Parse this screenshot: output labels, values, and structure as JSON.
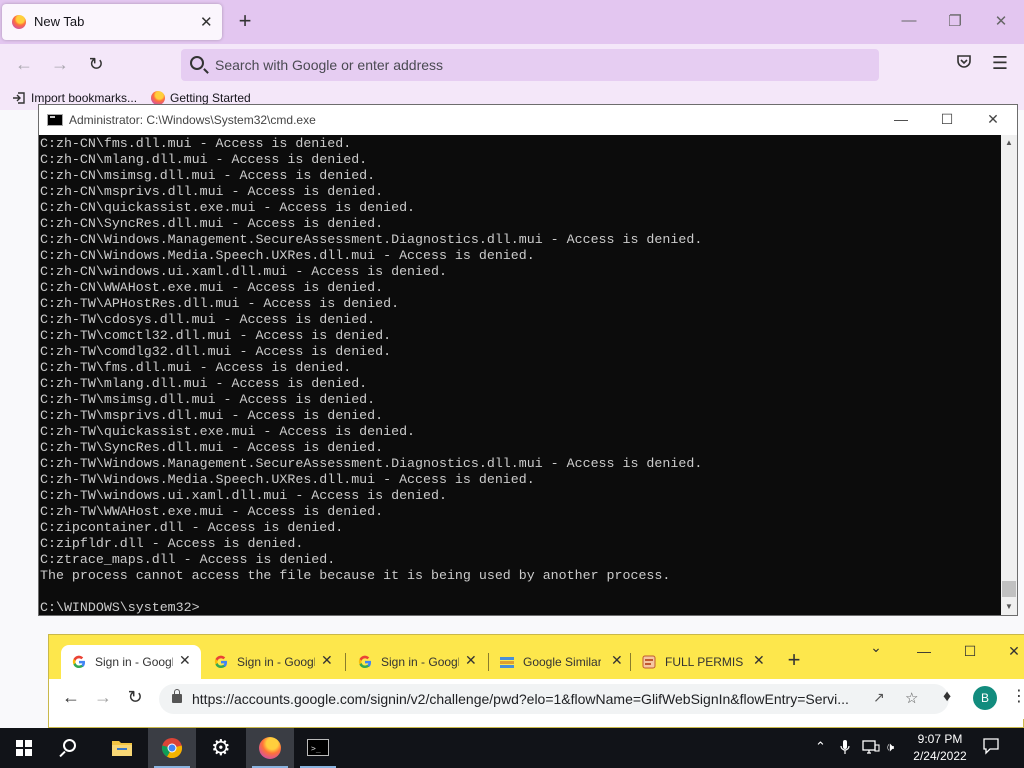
{
  "firefox": {
    "tab_title": "New Tab",
    "tab_close": "✕",
    "new_tab": "+",
    "url_placeholder": "Search with Google or enter address",
    "bookmarks": [
      {
        "label": "Import bookmarks..."
      },
      {
        "label": "Getting Started"
      }
    ],
    "win_minimize": "—",
    "win_restore": "❐",
    "win_close": "✕"
  },
  "cmd": {
    "title": "Administrator: C:\\Windows\\System32\\cmd.exe",
    "lines": [
      "C:zh-CN\\fms.dll.mui - Access is denied.",
      "C:zh-CN\\mlang.dll.mui - Access is denied.",
      "C:zh-CN\\msimsg.dll.mui - Access is denied.",
      "C:zh-CN\\msprivs.dll.mui - Access is denied.",
      "C:zh-CN\\quickassist.exe.mui - Access is denied.",
      "C:zh-CN\\SyncRes.dll.mui - Access is denied.",
      "C:zh-CN\\Windows.Management.SecureAssessment.Diagnostics.dll.mui - Access is denied.",
      "C:zh-CN\\Windows.Media.Speech.UXRes.dll.mui - Access is denied.",
      "C:zh-CN\\windows.ui.xaml.dll.mui - Access is denied.",
      "C:zh-CN\\WWAHost.exe.mui - Access is denied.",
      "C:zh-TW\\APHostRes.dll.mui - Access is denied.",
      "C:zh-TW\\cdosys.dll.mui - Access is denied.",
      "C:zh-TW\\comctl32.dll.mui - Access is denied.",
      "C:zh-TW\\comdlg32.dll.mui - Access is denied.",
      "C:zh-TW\\fms.dll.mui - Access is denied.",
      "C:zh-TW\\mlang.dll.mui - Access is denied.",
      "C:zh-TW\\msimsg.dll.mui - Access is denied.",
      "C:zh-TW\\msprivs.dll.mui - Access is denied.",
      "C:zh-TW\\quickassist.exe.mui - Access is denied.",
      "C:zh-TW\\SyncRes.dll.mui - Access is denied.",
      "C:zh-TW\\Windows.Management.SecureAssessment.Diagnostics.dll.mui - Access is denied.",
      "C:zh-TW\\Windows.Media.Speech.UXRes.dll.mui - Access is denied.",
      "C:zh-TW\\windows.ui.xaml.dll.mui - Access is denied.",
      "C:zh-TW\\WWAHost.exe.mui - Access is denied.",
      "C:zipcontainer.dll - Access is denied.",
      "C:zipfldr.dll - Access is denied.",
      "C:ztrace_maps.dll - Access is denied.",
      "The process cannot access the file because it is being used by another process.",
      "",
      "C:\\WINDOWS\\system32>"
    ],
    "win_minimize": "—",
    "win_maximize": "☐",
    "win_close": "✕"
  },
  "chrome": {
    "tabs": [
      {
        "title": "Sign in - Google Accounts",
        "icon": "google-icon",
        "active": true
      },
      {
        "title": "Sign in - Google Accounts",
        "icon": "google-icon",
        "active": false
      },
      {
        "title": "Sign in - Google Accounts",
        "icon": "google-icon",
        "active": false
      },
      {
        "title": "Google Similar",
        "icon": "books-icon",
        "active": false
      },
      {
        "title": "FULL PERMISSIONS",
        "icon": "page-icon",
        "active": false
      }
    ],
    "tab_close": "✕",
    "new_tab": "+",
    "url": "https://accounts.google.com/signin/v2/challenge/pwd?elo=1&flowName=GlifWebSignIn&flowEntry=Servi...",
    "profile_initial": "B",
    "win_dropdown": "⌄",
    "win_minimize": "—",
    "win_maximize": "☐",
    "win_close": "✕",
    "accent": "#fde74c"
  },
  "taskbar": {
    "time": "9:07 PM",
    "date": "2/24/2022",
    "apps": [
      "start",
      "search",
      "file-explorer",
      "chrome",
      "settings",
      "firefox",
      "cmd"
    ]
  }
}
